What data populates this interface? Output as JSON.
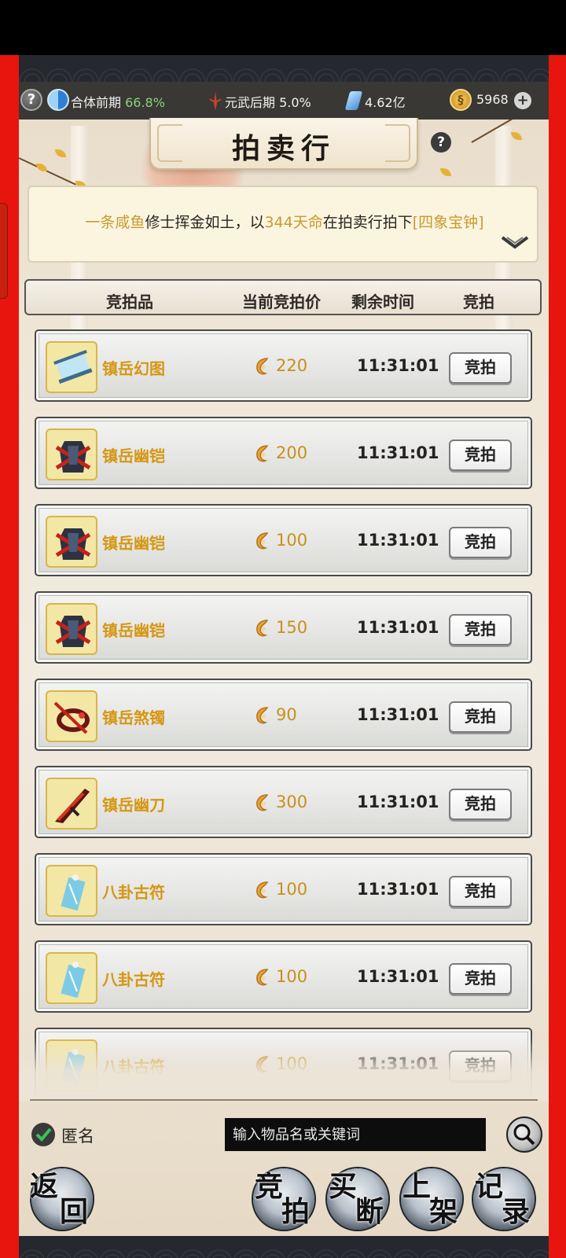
{
  "status_bar": {
    "realm_label": "合体前期",
    "realm_pct": "66.8%",
    "martial_label": "元武后期",
    "martial_pct": "5.0%",
    "spirit_stones": "4.62亿",
    "gold": "5968"
  },
  "title": "拍卖行",
  "notice": {
    "player": "一条咸鱼",
    "text1": "修士挥金如土，以",
    "amount": "344天命",
    "text2": "在拍卖行拍下",
    "item": "[四象宝钟]"
  },
  "table": {
    "headers": [
      "竞拍品",
      "当前竞拍价",
      "剩余时间",
      "竞拍"
    ],
    "rows": [
      {
        "name": "镇岳幻图",
        "price": "220",
        "time": "11:31:01",
        "action": "竞拍",
        "icon": "scroll-icon"
      },
      {
        "name": "镇岳幽铠",
        "price": "200",
        "time": "11:31:01",
        "action": "竞拍",
        "icon": "armor-icon"
      },
      {
        "name": "镇岳幽铠",
        "price": "100",
        "time": "11:31:01",
        "action": "竞拍",
        "icon": "armor-icon"
      },
      {
        "name": "镇岳幽铠",
        "price": "150",
        "time": "11:31:01",
        "action": "竞拍",
        "icon": "armor-icon"
      },
      {
        "name": "镇岳煞镯",
        "price": "90",
        "time": "11:31:01",
        "action": "竞拍",
        "icon": "bracelet-icon"
      },
      {
        "name": "镇岳幽刀",
        "price": "300",
        "time": "11:31:01",
        "action": "竞拍",
        "icon": "blade-icon"
      },
      {
        "name": "八卦古符",
        "price": "100",
        "time": "11:31:01",
        "action": "竞拍",
        "icon": "talisman-icon"
      },
      {
        "name": "八卦古符",
        "price": "100",
        "time": "11:31:01",
        "action": "竞拍",
        "icon": "talisman-icon"
      },
      {
        "name": "八卦古符",
        "price": "100",
        "time": "11:31:01",
        "action": "竞拍",
        "icon": "talisman-icon"
      }
    ]
  },
  "anonymous_label": "匿名",
  "search": {
    "placeholder": "输入物品名或关键词"
  },
  "nav": {
    "back": [
      "返",
      "回"
    ],
    "bid": [
      "竞",
      "拍"
    ],
    "buyout": [
      "买",
      "断"
    ],
    "list": [
      "上",
      "架"
    ],
    "record": [
      "记",
      "录"
    ]
  },
  "colors": {
    "accent_gold": "#d59712",
    "side_red": "#e8150f",
    "status_green": "#8bd07a"
  }
}
